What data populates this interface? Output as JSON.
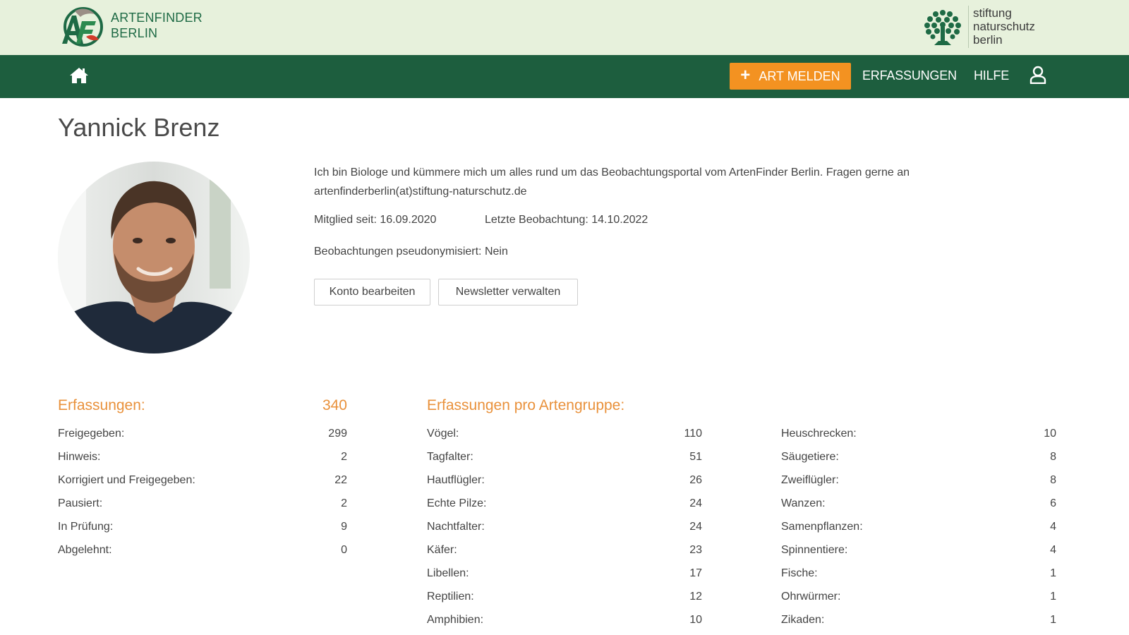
{
  "brand": {
    "line1": "ARTENFINDER",
    "line2": "BERLIN",
    "partner_line1": "stiftung",
    "partner_line2": "naturschutz",
    "partner_line3": "berlin",
    "primary_color": "#1d5e3e",
    "accent_color": "#f39221"
  },
  "nav": {
    "home_icon": "home-icon",
    "report_button": "ART MELDEN",
    "link_erfassungen": "ERFASSUNGEN",
    "link_hilfe": "HILFE",
    "user_icon": "user-icon"
  },
  "profile": {
    "name": "Yannick Brenz",
    "bio_line1": "Ich bin Biologe und kümmere mich um alles rund um das Beobachtungsportal vom ArtenFinder Berlin. Fragen gerne an",
    "bio_line2": "artenfinderberlin(at)stiftung-naturschutz.de",
    "member_since": "Mitglied seit: 16.09.2020",
    "last_observation": "Letzte Beobachtung: 14.10.2022",
    "pseudonymized": "Beobachtungen pseudonymisiert: Nein",
    "btn_account": "Konto bearbeiten",
    "btn_newsletter": "Newsletter verwalten"
  },
  "erfassungen": {
    "title": "Erfassungen:",
    "total": "340",
    "rows": [
      {
        "label": "Freigegeben:",
        "value": "299"
      },
      {
        "label": "Hinweis:",
        "value": "2"
      },
      {
        "label": "Korrigiert und Freigegeben:",
        "value": "22"
      },
      {
        "label": "Pausiert:",
        "value": "2"
      },
      {
        "label": "In Prüfung:",
        "value": "9"
      },
      {
        "label": "Abgelehnt:",
        "value": "0"
      }
    ]
  },
  "artengruppe": {
    "title": "Erfassungen pro Artengruppe:",
    "col1": [
      {
        "label": "Vögel:",
        "value": "110"
      },
      {
        "label": "Tagfalter:",
        "value": "51"
      },
      {
        "label": "Hautflügler:",
        "value": "26"
      },
      {
        "label": "Echte Pilze:",
        "value": "24"
      },
      {
        "label": "Nachtfalter:",
        "value": "24"
      },
      {
        "label": "Käfer:",
        "value": "23"
      },
      {
        "label": "Libellen:",
        "value": "17"
      },
      {
        "label": "Reptilien:",
        "value": "12"
      },
      {
        "label": "Amphibien:",
        "value": "10"
      }
    ],
    "col2": [
      {
        "label": "Heuschrecken:",
        "value": "10"
      },
      {
        "label": "Säugetiere:",
        "value": "8"
      },
      {
        "label": "Zweiflügler:",
        "value": "8"
      },
      {
        "label": "Wanzen:",
        "value": "6"
      },
      {
        "label": "Samenpflanzen:",
        "value": "4"
      },
      {
        "label": "Spinnentiere:",
        "value": "4"
      },
      {
        "label": "Fische:",
        "value": "1"
      },
      {
        "label": "Ohrwürmer:",
        "value": "1"
      },
      {
        "label": "Zikaden:",
        "value": "1"
      }
    ]
  }
}
